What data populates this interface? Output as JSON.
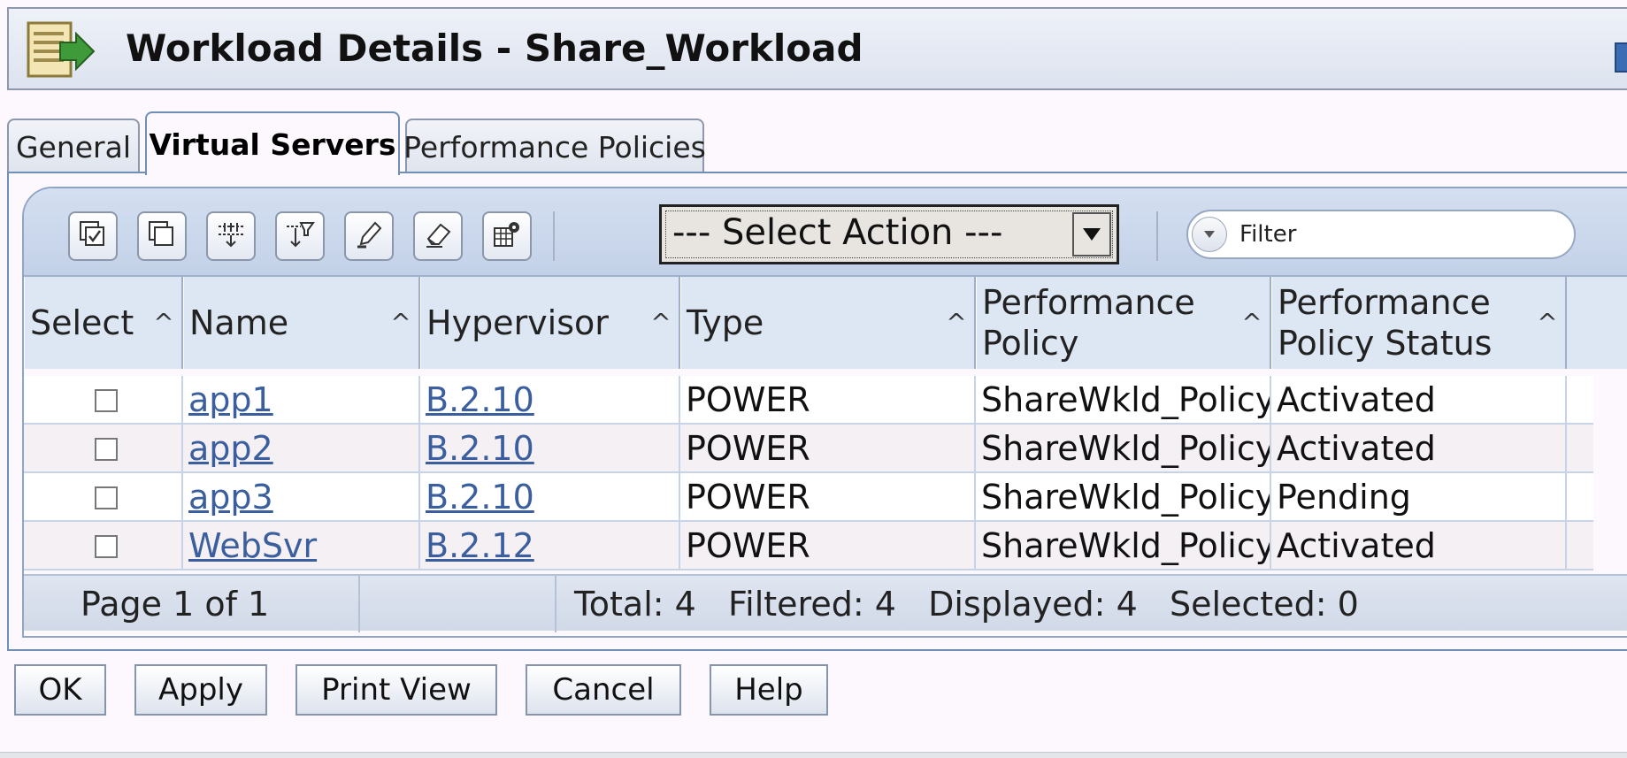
{
  "window": {
    "title": "Workload Details - Share_Workload"
  },
  "tabs": [
    {
      "label": "General",
      "active": false
    },
    {
      "label": "Virtual Servers",
      "active": true
    },
    {
      "label": "Performance Policies",
      "active": false
    }
  ],
  "toolbar": {
    "icons": [
      "select-all-icon",
      "deselect-all-icon",
      "expand-icon",
      "filter-rows-icon",
      "edit-icon",
      "erase-icon",
      "table-settings-icon"
    ],
    "select_action": "--- Select Action ---",
    "filter_placeholder": "Filter"
  },
  "table": {
    "columns": [
      "Select",
      "Name",
      "Hypervisor",
      "Type",
      "Performance Policy",
      "Performance Policy Status"
    ],
    "rows": [
      {
        "name": "app1",
        "hypervisor": "B.2.10",
        "type": "POWER",
        "policy": "ShareWkld_Policy",
        "status": "Activated",
        "selected": false
      },
      {
        "name": "app2",
        "hypervisor": "B.2.10",
        "type": "POWER",
        "policy": "ShareWkld_Policy",
        "status": "Activated",
        "selected": false
      },
      {
        "name": "app3",
        "hypervisor": "B.2.10",
        "type": "POWER",
        "policy": "ShareWkld_Policy",
        "status": "Pending",
        "selected": false
      },
      {
        "name": "WebSvr",
        "hypervisor": "B.2.12",
        "type": "POWER",
        "policy": "ShareWkld_Policy",
        "status": "Activated",
        "selected": false
      }
    ]
  },
  "footer": {
    "page": "Page 1 of 1",
    "summary": "Total: 4   Filtered: 4   Displayed: 4   Selected: 0"
  },
  "buttons": {
    "ok": "OK",
    "apply": "Apply",
    "print_view": "Print View",
    "cancel": "Cancel",
    "help": "Help"
  },
  "colors": {
    "accent": "#6f8fb7",
    "link": "#3b5f9e",
    "header_bg": "#dde6f3"
  }
}
